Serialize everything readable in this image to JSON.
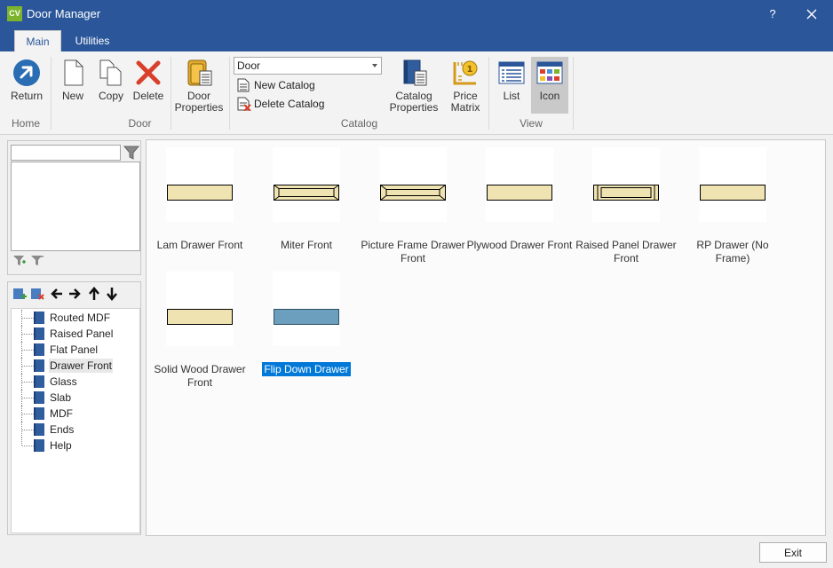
{
  "window": {
    "app_badge": "CV",
    "title": "Door Manager",
    "help": "?"
  },
  "tabs": [
    {
      "label": "Main"
    },
    {
      "label": "Utilities"
    }
  ],
  "ribbon": {
    "return_label": "Return",
    "new_label": "New",
    "copy_label": "Copy",
    "delete_label": "Delete",
    "door_properties_label": "Door Properties",
    "catalog_select": "Door",
    "new_catalog_label": "New Catalog",
    "delete_catalog_label": "Delete Catalog",
    "catalog_properties_label": "Catalog Properties",
    "price_matrix_label": "Price Matrix",
    "list_label": "List",
    "icon_label": "Icon",
    "groups": {
      "home": "Home",
      "door": "Door",
      "catalog": "Catalog",
      "view": "View"
    }
  },
  "filter": {
    "value": ""
  },
  "tree": {
    "items": [
      {
        "label": "Routed MDF"
      },
      {
        "label": "Raised Panel"
      },
      {
        "label": "Flat Panel"
      },
      {
        "label": "Drawer Front"
      },
      {
        "label": "Glass"
      },
      {
        "label": "Slab"
      },
      {
        "label": "MDF"
      },
      {
        "label": "Ends"
      },
      {
        "label": "Help"
      }
    ],
    "hover_index": 3
  },
  "doors": [
    {
      "label": "Lam Drawer Front",
      "style": "plain"
    },
    {
      "label": "Miter Front",
      "style": "miter"
    },
    {
      "label": "Picture Frame Drawer Front",
      "style": "picture"
    },
    {
      "label": "Plywood Drawer Front",
      "style": "plain"
    },
    {
      "label": "Raised Panel Drawer Front",
      "style": "raised"
    },
    {
      "label": "RP Drawer (No Frame)",
      "style": "plain"
    },
    {
      "label": "Solid Wood Drawer Front",
      "style": "plain"
    },
    {
      "label": "Flip Down Drawer",
      "style": "blue",
      "selected": true
    }
  ],
  "exit_label": "Exit",
  "colors": {
    "titlebar": "#2b579a",
    "selection": "#0078d7",
    "door_fill": "#efe3b1",
    "door_selected_fill": "#6c9fbd"
  }
}
